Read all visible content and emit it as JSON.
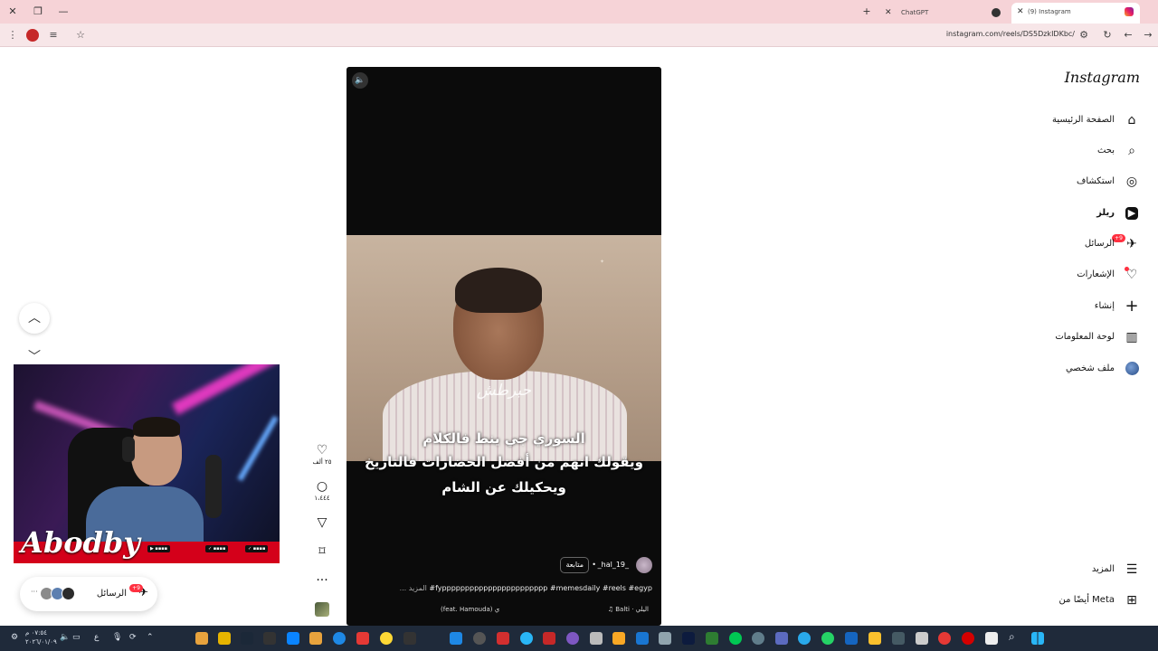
{
  "browser": {
    "tabs": [
      {
        "title": "ChatGPT"
      },
      {
        "title": "(9) Instagram"
      }
    ],
    "url": "instagram.com/reels/DS5DzkIDKbc/"
  },
  "instagram": {
    "logo": "Instagram",
    "nav": [
      {
        "label": "الصفحة الرئيسية",
        "icon": "⌂"
      },
      {
        "label": "بحث",
        "icon": "⌕"
      },
      {
        "label": "استكشاف",
        "icon": "◎"
      },
      {
        "label": "ريلز",
        "icon": "▶"
      },
      {
        "label": "الرسائل",
        "icon": "✈",
        "badge": "+9"
      },
      {
        "label": "الإشعارات",
        "icon": "♡"
      },
      {
        "label": "إنشاء",
        "icon": "+"
      },
      {
        "label": "لوحة المعلومات",
        "icon": "▥"
      },
      {
        "label": "ملف شخصي",
        "icon": ""
      }
    ],
    "more_label": "المزيد",
    "meta_label": "أيضًا من Meta"
  },
  "reel": {
    "overlay_text": "حبرطش",
    "subtitle_lines": [
      "السوري جي ينط فالكلام",
      "ويقولك انهم من أفضل الحضارات فالتاريخ",
      "ويحكيلك عن الشام"
    ],
    "author": "_hal_19_",
    "follow_label": "متابعة",
    "caption": "#fyppppppppppppppppppppppp #memesdaily #reels #egyp",
    "caption_more": "... المزيد",
    "audio_right": "♫ Balti · اليلي",
    "audio_left": "(feat. Hamouda) ي",
    "likes": "٢٥ ألف",
    "comments": "١،٤٤٤"
  },
  "floating_messages": {
    "label": "الرسائل",
    "badge": "+9"
  },
  "webcam": {
    "brand": "Abodby"
  },
  "taskbar": {
    "time": "٠٧:٥٤ م",
    "date": "٢٠٢٦/٠١/٠٩",
    "lang": "ع"
  }
}
